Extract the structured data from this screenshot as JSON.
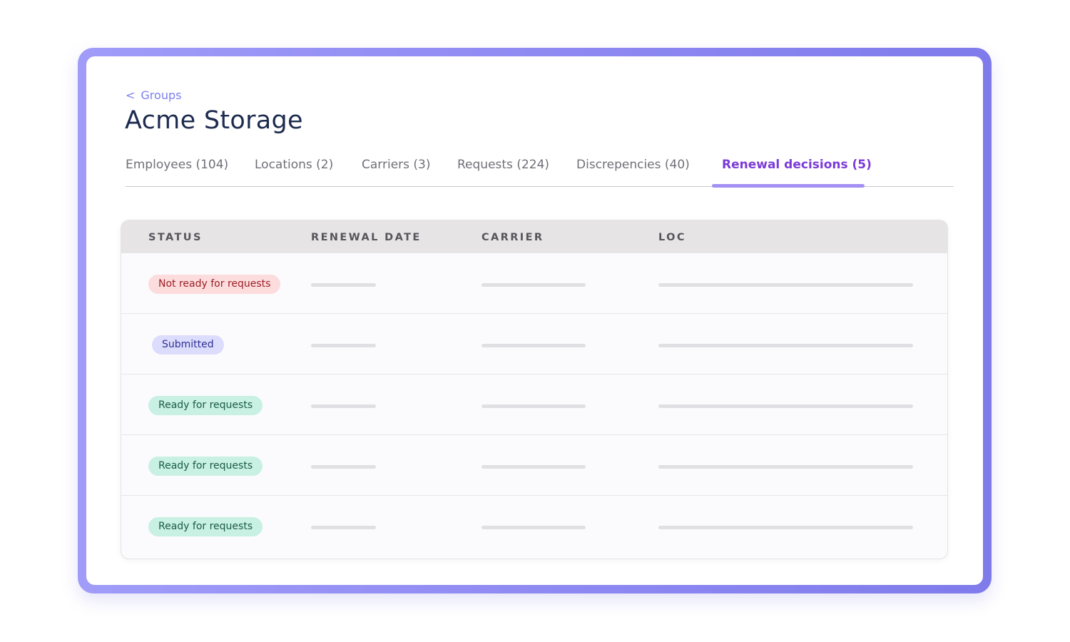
{
  "breadcrumb": {
    "chevron": "<",
    "label": "Groups"
  },
  "title": "Acme Storage",
  "tabs": [
    {
      "label": "Employees (104)",
      "active": false
    },
    {
      "label": "Locations (2)",
      "active": false
    },
    {
      "label": "Carriers (3)",
      "active": false
    },
    {
      "label": "Requests (224)",
      "active": false
    },
    {
      "label": "Discrepencies (40)",
      "active": false
    },
    {
      "label": "Renewal decisions (5)",
      "active": true
    }
  ],
  "table": {
    "columns": [
      "STATUS",
      "RENEWAL DATE",
      "CARRIER",
      "LOC"
    ],
    "rows": [
      {
        "status": "Not ready for requests",
        "tone": "red"
      },
      {
        "status": "Submitted",
        "tone": "blue"
      },
      {
        "status": "Ready for requests",
        "tone": "green"
      },
      {
        "status": "Ready for requests",
        "tone": "green"
      },
      {
        "status": "Ready for requests",
        "tone": "green"
      }
    ]
  },
  "colors": {
    "frame": "#8f8af2",
    "accent_tab": "#7a3bd9",
    "breadcrumb": "#7c7ff0",
    "title": "#1d2b4f",
    "badge_red_bg": "#fcdcdc",
    "badge_blue_bg": "#dcdcfc",
    "badge_green_bg": "#c8f0e3"
  }
}
